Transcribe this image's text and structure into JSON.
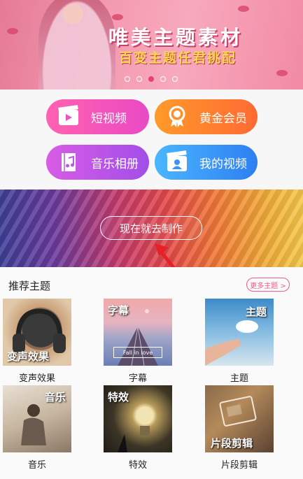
{
  "banner": {
    "title": "唯美主题素材",
    "subtitle": "百变主题任君挑配",
    "dots_total": 5,
    "active_dot": 3
  },
  "actions": [
    {
      "label": "短视频",
      "icon": "film-icon"
    },
    {
      "label": "黄金会员",
      "icon": "medal-icon"
    },
    {
      "label": "音乐相册",
      "icon": "music-album-icon"
    },
    {
      "label": "我的视频",
      "icon": "my-video-icon"
    }
  ],
  "make_now": {
    "label": "现在就去制作"
  },
  "recommended": {
    "title": "推荐主题",
    "more": "更多主题 >",
    "items": [
      {
        "caption": "变声效果",
        "tag": "变声效果"
      },
      {
        "caption": "字幕",
        "tag": "字幕",
        "sub": "Fall in love"
      },
      {
        "caption": "主题",
        "tag": "主题"
      },
      {
        "caption": "音乐",
        "tag": "音乐"
      },
      {
        "caption": "特效",
        "tag": "特效"
      },
      {
        "caption": "片段剪辑",
        "tag": "片段剪辑"
      }
    ]
  },
  "colors": {
    "accent_pink": "#f05a8c",
    "arrow_red": "#e8202a"
  }
}
